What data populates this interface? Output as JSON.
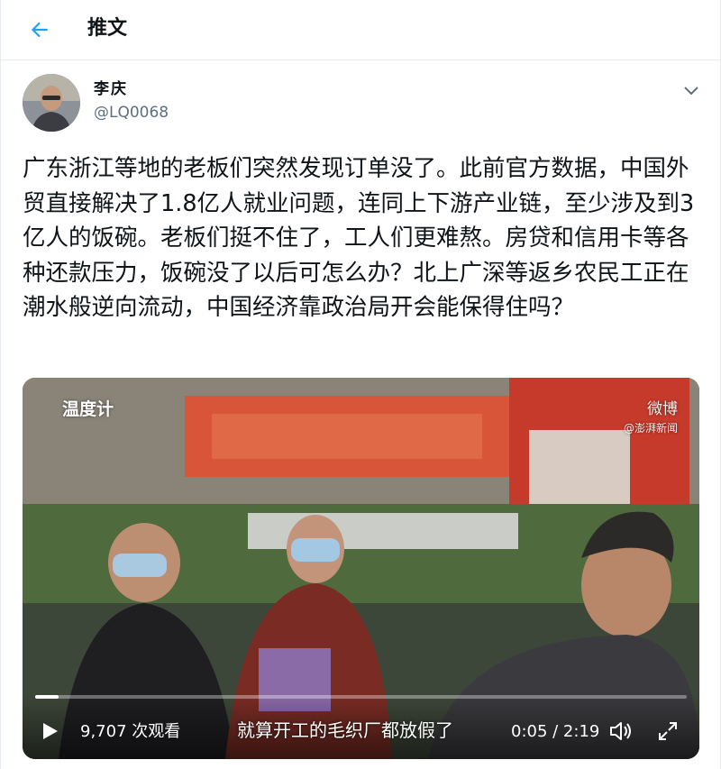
{
  "header": {
    "title": "推文",
    "back_icon": "back-arrow-icon"
  },
  "tweet": {
    "author_name": "李庆",
    "author_handle": "@LQ0068",
    "text": "广东浙江等地的老板们突然发现订单没了。此前官方数据，中国外贸直接解决了1.8亿人就业问题，连同上下游产业链，至少涉及到3亿人的饭碗。老板们挺不住了，工人们更难熬。房贷和信用卡等各种还款压力，饭碗没了以后可怎么办？北上广深等返乡农民工正在潮水般逆向流动，中国经济靠政治局开会能保得住吗？"
  },
  "video": {
    "watermark_left": "温度计",
    "watermark_right": "微博",
    "watermark_right_sub": "@澎湃新闻",
    "views": "9,707 次观看",
    "subtitle": "就算开工的毛织厂都放假了",
    "time": "0:05 / 2:19",
    "progress_fraction": 0.036
  },
  "colors": {
    "accent": "#1da1f2",
    "muted": "#5b7083",
    "border": "#e6ecf0"
  }
}
